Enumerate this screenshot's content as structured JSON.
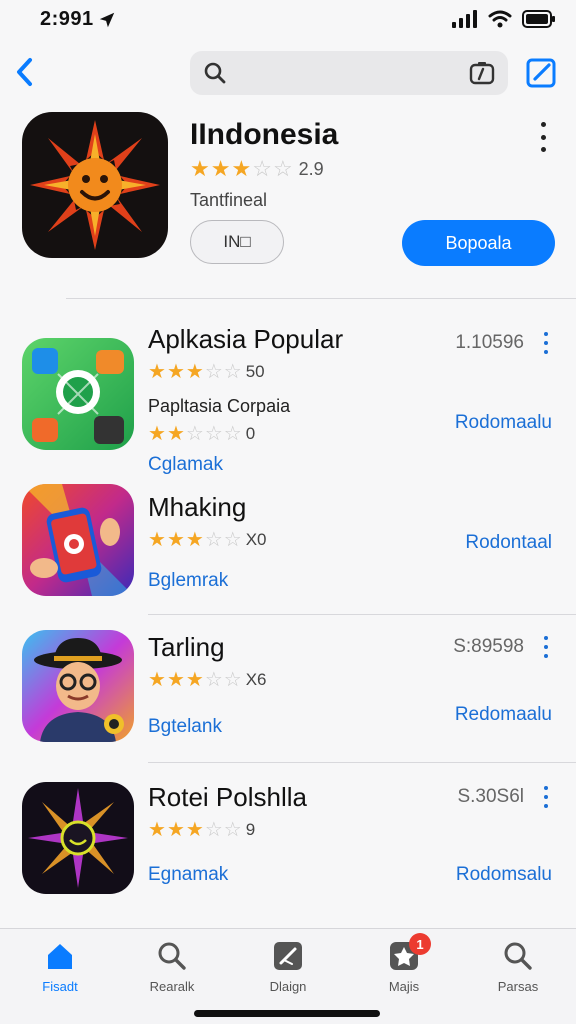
{
  "status_bar": {
    "time": "2:991"
  },
  "top_nav": {
    "search_placeholder": ""
  },
  "featured": {
    "title": "IIndonesia",
    "stars": 3,
    "rating_text": "2.9",
    "subtitle": "Tantfineal",
    "secondary_button": "IN□",
    "primary_button": "Bopoala"
  },
  "apps": [
    {
      "title": "Aplkasia Popular",
      "stars": 3,
      "rating_text": "50",
      "size": "1.10596",
      "subtitle": "Papltasia Corpaia",
      "sub_stars": 2,
      "sub_rating_text": "0",
      "category": "Cglamak",
      "action": "Rodomaalu"
    },
    {
      "title": "Mhaking",
      "stars": 3,
      "rating_text": "X0",
      "size": "",
      "category": "Bglemrak",
      "action": "Rodontaal"
    },
    {
      "title": "Tarling",
      "stars": 3,
      "rating_text": "X6",
      "size": "S:89598",
      "category": "Bgtelank",
      "action": "Redomaalu"
    },
    {
      "title": "Rotei Polshlla",
      "stars": 3,
      "rating_text": "9",
      "size": "S.30S6l",
      "category": "Egnamak",
      "action": "Rodomsalu"
    }
  ],
  "tabs": [
    {
      "label": "Fisadt",
      "icon": "home-icon",
      "active": true
    },
    {
      "label": "Rearalk",
      "icon": "search-icon",
      "active": false
    },
    {
      "label": "Dlaign",
      "icon": "design-icon",
      "active": false
    },
    {
      "label": "Majis",
      "icon": "apps-icon",
      "active": false,
      "badge": "1"
    },
    {
      "label": "Parsas",
      "icon": "search-icon",
      "active": false
    }
  ],
  "colors": {
    "accent": "#0a7cff",
    "link": "#1b6fd6",
    "star": "#f5a623",
    "badge": "#ec3b30"
  }
}
